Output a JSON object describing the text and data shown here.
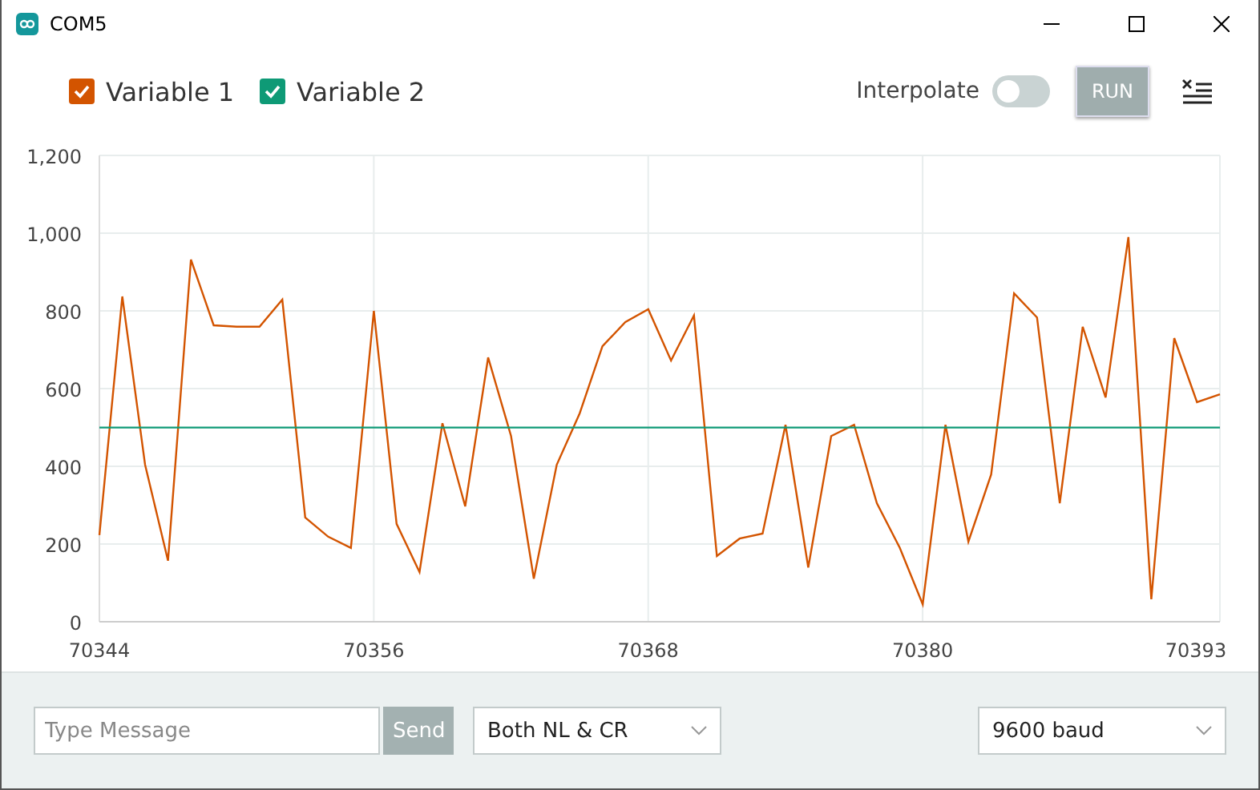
{
  "window": {
    "title": "COM5"
  },
  "legend": [
    {
      "checked": true
    },
    {
      "checked": true
    }
  ],
  "interpolate": {
    "label": "Interpolate",
    "on": false
  },
  "run_button": {
    "label": "RUN",
    "disabled": true
  },
  "chart_data": {
    "type": "line",
    "grid": true,
    "x": [
      70344,
      70345,
      70346,
      70347,
      70348,
      70349,
      70350,
      70351,
      70352,
      70353,
      70354,
      70355,
      70356,
      70357,
      70358,
      70359,
      70360,
      70361,
      70362,
      70363,
      70364,
      70365,
      70366,
      70367,
      70368,
      70369,
      70370,
      70371,
      70372,
      70373,
      70374,
      70375,
      70376,
      70377,
      70378,
      70379,
      70380,
      70381,
      70382,
      70383,
      70384,
      70385,
      70386,
      70387,
      70388,
      70389,
      70390,
      70391,
      70392,
      70393
    ],
    "series": [
      {
        "name": "Variable 1",
        "color": "#d35400",
        "values": [
          223,
          837,
          404,
          157,
          932,
          763,
          759,
          759,
          829,
          268,
          219,
          190,
          800,
          252,
          128,
          511,
          297,
          680,
          478,
          111,
          404,
          536,
          709,
          771,
          804,
          672,
          788,
          169,
          214,
          227,
          507,
          140,
          478,
          507,
          305,
          190,
          45,
          507,
          206,
          379,
          845,
          783,
          305,
          759,
          577,
          990,
          58,
          730,
          565,
          585
        ]
      },
      {
        "name": "Variable 2",
        "color": "#0e9a76",
        "values": [
          500,
          500,
          500,
          500,
          500,
          500,
          500,
          500,
          500,
          500,
          500,
          500,
          500,
          500,
          500,
          500,
          500,
          500,
          500,
          500,
          500,
          500,
          500,
          500,
          500,
          500,
          500,
          500,
          500,
          500,
          500,
          500,
          500,
          500,
          500,
          500,
          500,
          500,
          500,
          500,
          500,
          500,
          500,
          500,
          500,
          500,
          500,
          500,
          500,
          500
        ]
      }
    ],
    "xlim": [
      70344,
      70393
    ],
    "ylim": [
      0,
      1200
    ],
    "xticks": [
      70344,
      70356,
      70368,
      70380,
      70393
    ],
    "yticks": [
      {
        "value": 0,
        "label": "0"
      },
      {
        "value": 200,
        "label": "200"
      },
      {
        "value": 400,
        "label": "400"
      },
      {
        "value": 600,
        "label": "600"
      },
      {
        "value": 800,
        "label": "800"
      },
      {
        "value": 1000,
        "label": "1,000"
      },
      {
        "value": 1200,
        "label": "1,200"
      }
    ]
  },
  "message_field": {
    "placeholder": "Type Message"
  },
  "send_button": {
    "label": "Send",
    "disabled": true
  },
  "line_ending": {
    "value": "Both NL & CR"
  },
  "baud_rate": {
    "value": "9600 baud"
  }
}
